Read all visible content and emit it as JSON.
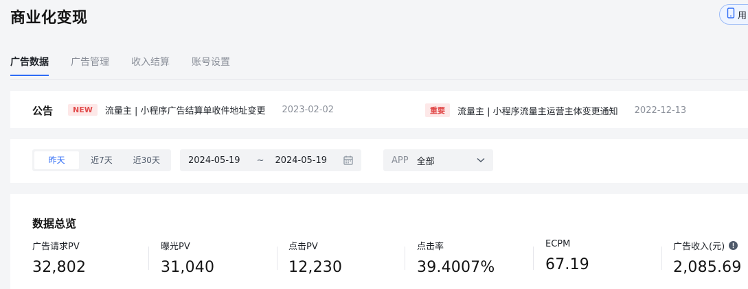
{
  "header": {
    "title": "商业化变现",
    "pill_label": "用"
  },
  "tabs": [
    {
      "label": "广告数据",
      "active": true
    },
    {
      "label": "广告管理"
    },
    {
      "label": "收入结算"
    },
    {
      "label": "账号设置"
    }
  ],
  "notice": {
    "title": "公告",
    "items": [
      {
        "tag": "NEW",
        "text": "流量主 | 小程序广告结算单收件地址变更",
        "date": "2023-02-02"
      },
      {
        "tag": "重要",
        "text": "流量主 | 小程序流量主运营主体变更通知",
        "date": "2022-12-13"
      }
    ]
  },
  "filter": {
    "segments": [
      "昨天",
      "近7天",
      "近30天"
    ],
    "date_start": "2024-05-19",
    "date_sep": "~",
    "date_end": "2024-05-19",
    "app_label": "APP",
    "app_value": "全部"
  },
  "overview": {
    "title": "数据总览",
    "metrics": [
      {
        "label": "广告请求PV",
        "value": "32,802"
      },
      {
        "label": "曝光PV",
        "value": "31,040"
      },
      {
        "label": "点击PV",
        "value": "12,230"
      },
      {
        "label": "点击率",
        "value": "39.4007%"
      },
      {
        "label": "ECPM",
        "value": "67.19"
      },
      {
        "label": "广告收入(元)",
        "value": "2,085.69"
      }
    ]
  },
  "colors": {
    "accent": "#2d6bf6",
    "tag_bg": "#fde8e8",
    "tag_text": "#e14b4b"
  }
}
